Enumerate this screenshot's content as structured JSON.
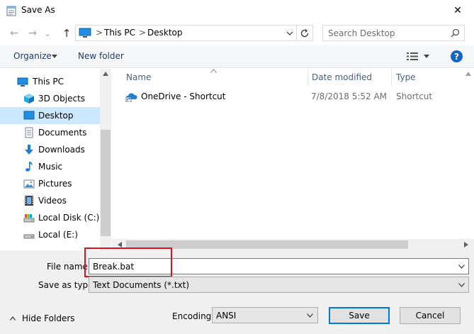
{
  "window": {
    "title": "Save As",
    "close_glyph": "✕",
    "title_icon": "notepad-icon"
  },
  "navigation": {
    "back_glyph": "←",
    "forward_glyph": "→",
    "history_glyph": "⌄",
    "up_glyph": "↑"
  },
  "address": {
    "crumbs": [
      "This PC",
      "Desktop"
    ],
    "separator": ">",
    "icon": "computer-icon"
  },
  "search": {
    "placeholder": "Search Desktop"
  },
  "toolbar": {
    "organize_label": "Organize",
    "new_folder_label": "New folder",
    "help_glyph": "?"
  },
  "nav_pane": {
    "items": [
      {
        "label": "This PC",
        "icon": "computer-icon",
        "selected": false
      },
      {
        "label": "3D Objects",
        "icon": "cube-icon",
        "selected": false
      },
      {
        "label": "Desktop",
        "icon": "desktop-icon",
        "selected": true
      },
      {
        "label": "Documents",
        "icon": "documents-icon",
        "selected": false
      },
      {
        "label": "Downloads",
        "icon": "download-arrow-icon",
        "selected": false
      },
      {
        "label": "Music",
        "icon": "music-note-icon",
        "selected": false
      },
      {
        "label": "Pictures",
        "icon": "pictures-icon",
        "selected": false
      },
      {
        "label": "Videos",
        "icon": "film-icon",
        "selected": false
      },
      {
        "label": "Local Disk (C:)",
        "icon": "drive-icon",
        "selected": false
      },
      {
        "label": "Local (E:)",
        "icon": "drive-icon",
        "selected": false
      }
    ]
  },
  "file_list": {
    "columns": [
      "Name",
      "Date modified",
      "Type"
    ],
    "rows": [
      {
        "name": "OneDrive - Shortcut",
        "date": "7/8/2018 5:52 AM",
        "type": "Shortcut",
        "icon": "onedrive-shortcut-icon"
      }
    ]
  },
  "form": {
    "file_name_label": "File name:",
    "file_name_value": "Break.bat",
    "save_type_label": "Save as type:",
    "save_type_value": "Text Documents (*.txt)",
    "hide_folders_label": "Hide Folders",
    "encoding_label": "Encoding:",
    "encoding_value": "ANSI",
    "save_label": "Save",
    "cancel_label": "Cancel"
  },
  "colors": {
    "selection": "#cce8ff",
    "highlight_box": "#e0101a",
    "default_button_border": "#0078d7",
    "help_badge": "#1364c4"
  }
}
